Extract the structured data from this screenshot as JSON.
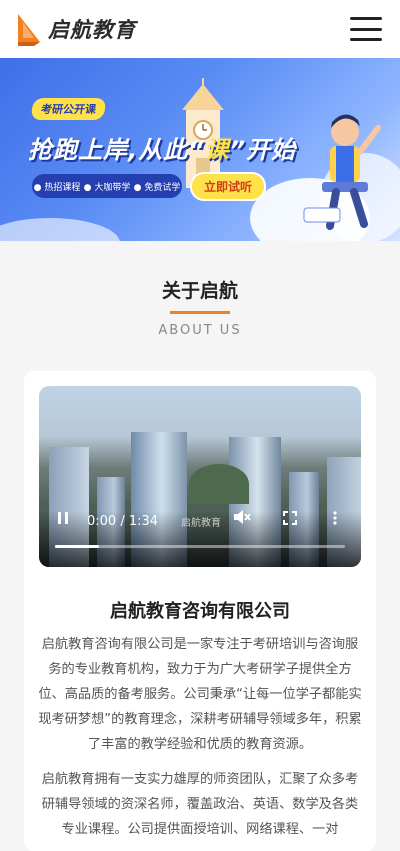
{
  "header": {
    "logo_text": "启航教育",
    "logo_color": "#f08020"
  },
  "banner": {
    "tag": "考研公开课",
    "headline_prefix": "抢跑上岸,从此“",
    "headline_highlight": "课",
    "headline_suffix": "”开始",
    "pills": [
      "热招课程",
      "大咖带学",
      "免费试学"
    ],
    "cta": "立即试听",
    "slide_count": 4,
    "active_slide": 1
  },
  "about": {
    "title": "关于启航",
    "subtitle": "ABOUT US"
  },
  "video": {
    "time": "0:00 / 1:34",
    "progress": 0.15,
    "watermark": "启航教育"
  },
  "company": {
    "name": "启航教育咨询有限公司",
    "paragraph1": "启航教育咨询有限公司是一家专注于考研培训与咨询服务的专业教育机构，致力于为广大考研学子提供全方位、高品质的备考服务。公司秉承“让每一位学子都能实现考研梦想”的教育理念，深耕考研辅导领域多年，积累了丰富的教学经验和优质的教育资源。",
    "paragraph2": "启航教育拥有一支实力雄厚的师资团队，汇聚了众多考研辅导领域的资深名师，覆盖政治、英语、数学及各类专业课程。公司提供面授培训、网络课程、一对"
  },
  "colors": {
    "accent": "#f08020",
    "banner_blue": "#3f6fe8",
    "dot_active": "#2f6df0"
  }
}
